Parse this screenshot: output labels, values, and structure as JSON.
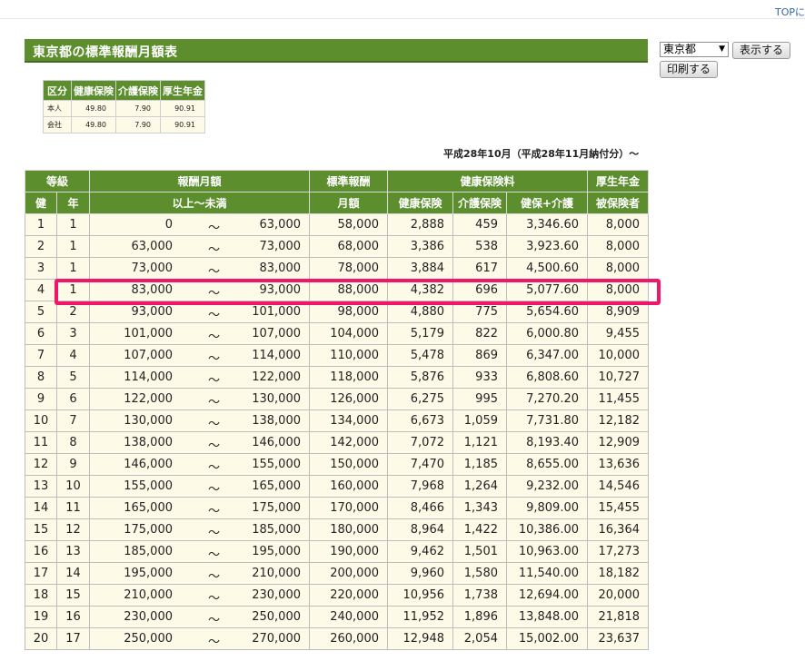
{
  "header": {
    "top_link": "TOPに",
    "title": "東京都の標準報酬月額表"
  },
  "controls": {
    "prefecture": "東京都",
    "show_button": "表示する",
    "print_button": "印刷する"
  },
  "rate_table": {
    "headers": [
      "区分",
      "健康保険",
      "介護保険",
      "厚生年金"
    ],
    "rows": [
      [
        "本人",
        "49.80",
        "7.90",
        "90.91"
      ],
      [
        "会社",
        "49.80",
        "7.90",
        "90.91"
      ]
    ]
  },
  "era_note": "平成28年10月（平成28年11月納付分）〜",
  "grade_table": {
    "head1": {
      "grade": "等級",
      "pay": "報酬月額",
      "standard": "標準報酬",
      "health": "健康保険料",
      "pension": "厚生年金"
    },
    "head2": {
      "ken": "健",
      "nen": "年",
      "range": "以上〜未満",
      "monthly": "月額",
      "health_ins": "健康保険",
      "care_ins": "介護保険",
      "health_care": "健保+介護",
      "insured": "被保険者"
    },
    "tilde": "〜",
    "rows": [
      {
        "ken": "1",
        "nen": "1",
        "lo": "0",
        "hi": "63,000",
        "std": "58,000",
        "hi_ins": "2,888",
        "care": "459",
        "total": "3,346.60",
        "pen": "8,000"
      },
      {
        "ken": "2",
        "nen": "1",
        "lo": "63,000",
        "hi": "73,000",
        "std": "68,000",
        "hi_ins": "3,386",
        "care": "538",
        "total": "3,923.60",
        "pen": "8,000"
      },
      {
        "ken": "3",
        "nen": "1",
        "lo": "73,000",
        "hi": "83,000",
        "std": "78,000",
        "hi_ins": "3,884",
        "care": "617",
        "total": "4,500.60",
        "pen": "8,000"
      },
      {
        "ken": "4",
        "nen": "1",
        "lo": "83,000",
        "hi": "93,000",
        "std": "88,000",
        "hi_ins": "4,382",
        "care": "696",
        "total": "5,077.60",
        "pen": "8,000"
      },
      {
        "ken": "5",
        "nen": "2",
        "lo": "93,000",
        "hi": "101,000",
        "std": "98,000",
        "hi_ins": "4,880",
        "care": "775",
        "total": "5,654.60",
        "pen": "8,909"
      },
      {
        "ken": "6",
        "nen": "3",
        "lo": "101,000",
        "hi": "107,000",
        "std": "104,000",
        "hi_ins": "5,179",
        "care": "822",
        "total": "6,000.80",
        "pen": "9,455"
      },
      {
        "ken": "7",
        "nen": "4",
        "lo": "107,000",
        "hi": "114,000",
        "std": "110,000",
        "hi_ins": "5,478",
        "care": "869",
        "total": "6,347.00",
        "pen": "10,000"
      },
      {
        "ken": "8",
        "nen": "5",
        "lo": "114,000",
        "hi": "122,000",
        "std": "118,000",
        "hi_ins": "5,876",
        "care": "933",
        "total": "6,808.60",
        "pen": "10,727"
      },
      {
        "ken": "9",
        "nen": "6",
        "lo": "122,000",
        "hi": "130,000",
        "std": "126,000",
        "hi_ins": "6,275",
        "care": "995",
        "total": "7,270.20",
        "pen": "11,455"
      },
      {
        "ken": "10",
        "nen": "7",
        "lo": "130,000",
        "hi": "138,000",
        "std": "134,000",
        "hi_ins": "6,673",
        "care": "1,059",
        "total": "7,731.80",
        "pen": "12,182"
      },
      {
        "ken": "11",
        "nen": "8",
        "lo": "138,000",
        "hi": "146,000",
        "std": "142,000",
        "hi_ins": "7,072",
        "care": "1,121",
        "total": "8,193.40",
        "pen": "12,909"
      },
      {
        "ken": "12",
        "nen": "9",
        "lo": "146,000",
        "hi": "155,000",
        "std": "150,000",
        "hi_ins": "7,470",
        "care": "1,185",
        "total": "8,655.00",
        "pen": "13,636"
      },
      {
        "ken": "13",
        "nen": "10",
        "lo": "155,000",
        "hi": "165,000",
        "std": "160,000",
        "hi_ins": "7,968",
        "care": "1,264",
        "total": "9,232.00",
        "pen": "14,546"
      },
      {
        "ken": "14",
        "nen": "11",
        "lo": "165,000",
        "hi": "175,000",
        "std": "170,000",
        "hi_ins": "8,466",
        "care": "1,343",
        "total": "9,809.00",
        "pen": "15,455"
      },
      {
        "ken": "15",
        "nen": "12",
        "lo": "175,000",
        "hi": "185,000",
        "std": "180,000",
        "hi_ins": "8,964",
        "care": "1,422",
        "total": "10,386.00",
        "pen": "16,364"
      },
      {
        "ken": "16",
        "nen": "13",
        "lo": "185,000",
        "hi": "195,000",
        "std": "190,000",
        "hi_ins": "9,462",
        "care": "1,501",
        "total": "10,963.00",
        "pen": "17,273"
      },
      {
        "ken": "17",
        "nen": "14",
        "lo": "195,000",
        "hi": "210,000",
        "std": "200,000",
        "hi_ins": "9,960",
        "care": "1,580",
        "total": "11,540.00",
        "pen": "18,182"
      },
      {
        "ken": "18",
        "nen": "15",
        "lo": "210,000",
        "hi": "230,000",
        "std": "220,000",
        "hi_ins": "10,956",
        "care": "1,738",
        "total": "12,694.00",
        "pen": "20,000"
      },
      {
        "ken": "19",
        "nen": "16",
        "lo": "230,000",
        "hi": "250,000",
        "std": "240,000",
        "hi_ins": "11,952",
        "care": "1,896",
        "total": "13,848.00",
        "pen": "21,818"
      },
      {
        "ken": "20",
        "nen": "17",
        "lo": "250,000",
        "hi": "270,000",
        "std": "260,000",
        "hi_ins": "12,948",
        "care": "2,054",
        "total": "15,002.00",
        "pen": "23,637"
      }
    ]
  },
  "highlight": {
    "row": "4",
    "color": "#f0166a"
  },
  "colors": {
    "header_green": "#5c8e2d",
    "cell_bg": "#fdfbe8"
  }
}
